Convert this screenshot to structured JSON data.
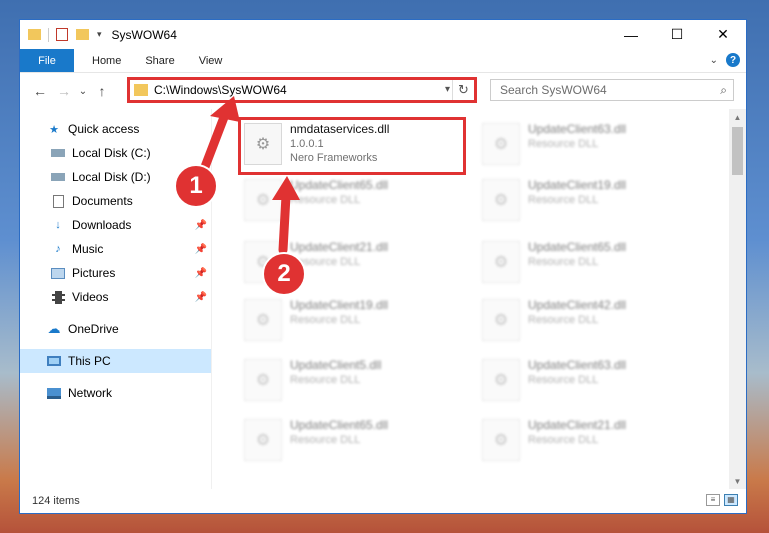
{
  "window": {
    "title": "SysWOW64",
    "controls": {
      "minimize": "—",
      "maximize": "☐",
      "close": "✕"
    }
  },
  "ribbon": {
    "tabs": [
      "File",
      "Home",
      "Share",
      "View"
    ],
    "help": "?"
  },
  "nav": {
    "back": "←",
    "forward": "→",
    "recent": "⌄",
    "up": "↑",
    "address": "C:\\Windows\\SysWOW64",
    "refresh": "↻",
    "search_placeholder": "Search SysWOW64"
  },
  "sidebar": {
    "items": [
      {
        "label": "Quick access",
        "icon": "star-icon"
      },
      {
        "label": "Local Disk (C:)",
        "icon": "drive-icon"
      },
      {
        "label": "Local Disk (D:)",
        "icon": "drive-icon"
      },
      {
        "label": "Documents",
        "icon": "documents-icon"
      },
      {
        "label": "Downloads",
        "icon": "download-icon"
      },
      {
        "label": "Music",
        "icon": "music-icon"
      },
      {
        "label": "Pictures",
        "icon": "pictures-icon"
      },
      {
        "label": "Videos",
        "icon": "videos-icon"
      },
      {
        "label": "OneDrive",
        "icon": "cloud-icon"
      },
      {
        "label": "This PC",
        "icon": "computer-icon"
      },
      {
        "label": "Network",
        "icon": "network-icon"
      }
    ]
  },
  "files": {
    "highlighted": {
      "name": "nmdataservices.dll",
      "version": "1.0.0.1",
      "company": "Nero Frameworks"
    },
    "items": [
      {
        "name": "UpdateClient63.dll",
        "type": "Resource DLL"
      },
      {
        "name": "UpdateClient65.dll",
        "type": "Resource DLL"
      },
      {
        "name": "UpdateClient19.dll",
        "type": "Resource DLL"
      },
      {
        "name": "UpdateClient21.dll",
        "type": "Resource DLL"
      },
      {
        "name": "UpdateClient65.dll",
        "type": "Resource DLL"
      },
      {
        "name": "UpdateClient19.dll",
        "type": "Resource DLL"
      },
      {
        "name": "UpdateClient42.dll",
        "type": "Resource DLL"
      },
      {
        "name": "UpdateClient5.dll",
        "type": "Resource DLL"
      },
      {
        "name": "UpdateClient63.dll",
        "type": "Resource DLL"
      },
      {
        "name": "UpdateClient65.dll",
        "type": "Resource DLL"
      },
      {
        "name": "UpdateClient21.dll",
        "type": "Resource DLL"
      }
    ]
  },
  "status": {
    "count": "124 items"
  },
  "annotations": {
    "step1": "1",
    "step2": "2"
  },
  "colors": {
    "accent": "#1979ca",
    "highlight": "#e03232",
    "selection": "#cce8ff"
  }
}
